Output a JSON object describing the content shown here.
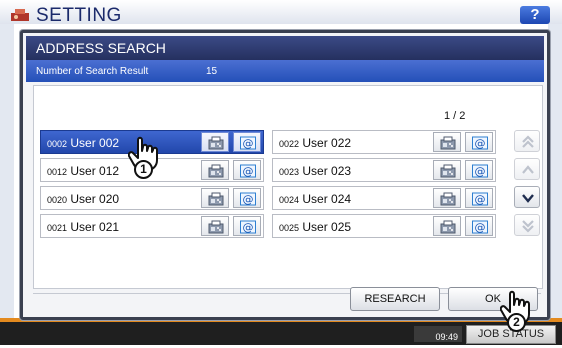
{
  "background": {
    "title": "SETTING",
    "help_label": "?",
    "clock": "09:49",
    "job_status": "JOB STATUS"
  },
  "dialog": {
    "title": "ADDRESS SEARCH",
    "result_label": "Number of Search Result",
    "result_count": "15",
    "page_indicator": "1  /  2",
    "left_entries": [
      {
        "num": "0002",
        "name": "User  002",
        "selected": true
      },
      {
        "num": "0012",
        "name": "User  012",
        "selected": false
      },
      {
        "num": "0020",
        "name": "User  020",
        "selected": false
      },
      {
        "num": "0021",
        "name": "User  021",
        "selected": false
      }
    ],
    "right_entries": [
      {
        "num": "0022",
        "name": "User  022"
      },
      {
        "num": "0023",
        "name": "User  023"
      },
      {
        "num": "0024",
        "name": "User  024"
      },
      {
        "num": "0025",
        "name": "User  025"
      }
    ],
    "research_label": "RESEARCH",
    "ok_label": "OK"
  },
  "callouts": [
    "1",
    "2"
  ],
  "icons": {
    "row_buttons": [
      "fax-icon",
      "email-icon"
    ],
    "scroll": [
      "double-chevron-up-icon",
      "chevron-up-icon",
      "chevron-down-icon",
      "double-chevron-down-icon"
    ],
    "hand": "hand-pointer-icon"
  },
  "colors": {
    "title_bar": "#2b3566",
    "result_bar": "#3a60c9",
    "selected_row": "#2f56bd",
    "footer_orange": "#e38a1f"
  }
}
